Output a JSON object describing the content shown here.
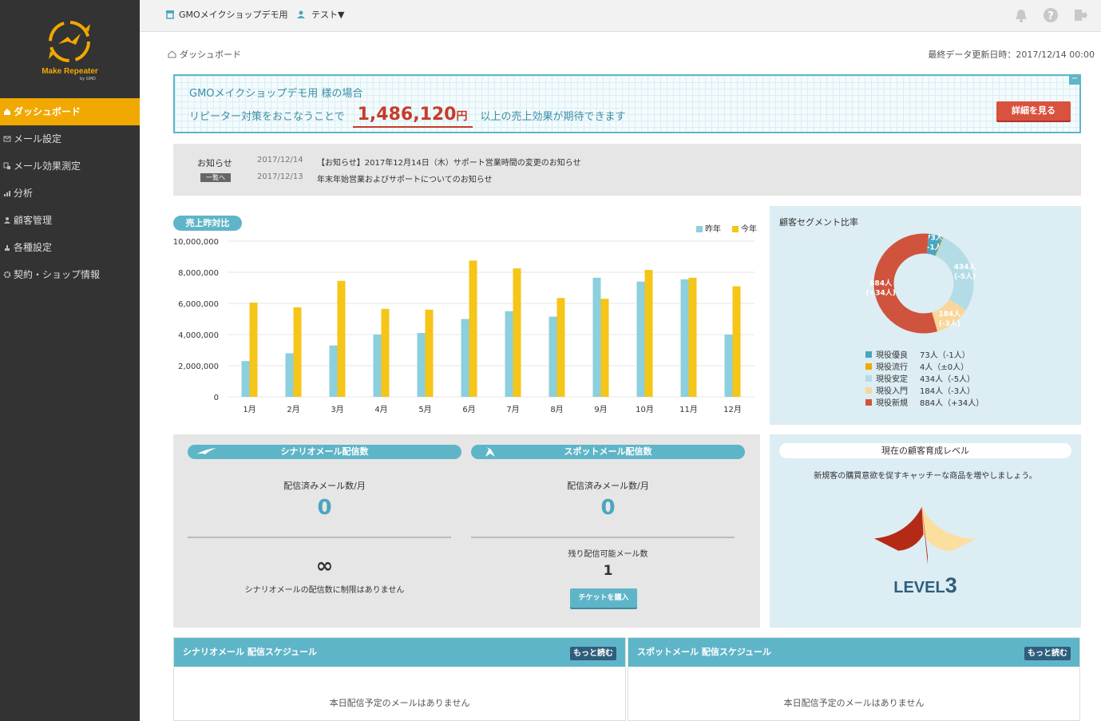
{
  "logo": {
    "text": "Make Repeater",
    "sub": "by GMO"
  },
  "nav": [
    {
      "label": "ダッシュボード",
      "icon": "home-icon",
      "active": true
    },
    {
      "label": "メール設定",
      "icon": "mail-icon"
    },
    {
      "label": "メール効果測定",
      "icon": "measure-icon"
    },
    {
      "label": "分析",
      "icon": "bar-chart-icon"
    },
    {
      "label": "顧客管理",
      "icon": "person-icon"
    },
    {
      "label": "各種設定",
      "icon": "settings-icon"
    },
    {
      "label": "契約・ショップ情報",
      "icon": "gear-icon"
    }
  ],
  "topbar": {
    "shop": "GMOメイクショップデモ用",
    "user": "テスト▼"
  },
  "breadcrumb": "ダッシュボード",
  "updated": "最終データ更新日時：2017/12/14 00:00",
  "banner": {
    "line1": "GMOメイクショップデモ用 様の場合",
    "prefix": "リピーター対策をおこなうことで",
    "amount": "1,486,120",
    "unit": "円",
    "suffix": "以上の売上効果が期待できます",
    "button": "詳細を見る",
    "minimize": "−"
  },
  "news": {
    "label": "お知らせ",
    "more": "一覧へ",
    "items": [
      {
        "date": "2017/12/14",
        "text": "【お知らせ】2017年12月14日（木）サポート営業時間の変更のお知らせ"
      },
      {
        "date": "2017/12/13",
        "text": "年末年始営業およびサポートについてのお知らせ"
      }
    ]
  },
  "sales": {
    "tag": "売上昨対比",
    "legend_prev": "昨年",
    "legend_curr": "今年"
  },
  "chart_data": {
    "type": "bar",
    "categories": [
      "1月",
      "2月",
      "3月",
      "4月",
      "5月",
      "6月",
      "7月",
      "8月",
      "9月",
      "10月",
      "11月",
      "12月"
    ],
    "series": [
      {
        "name": "昨年",
        "color": "#8ccfdd",
        "values": [
          2300000,
          2800000,
          3300000,
          4000000,
          4100000,
          5000000,
          5500000,
          5150000,
          7650000,
          7400000,
          7550000,
          4000000
        ]
      },
      {
        "name": "今年",
        "color": "#f5c518",
        "values": [
          6050000,
          5750000,
          7450000,
          5650000,
          5600000,
          8750000,
          8250000,
          6350000,
          6300000,
          8150000,
          7650000,
          7100000
        ]
      }
    ],
    "ylim": [
      0,
      10000000
    ],
    "yticks": [
      "0",
      "2,000,000",
      "4,000,000",
      "6,000,000",
      "8,000,000",
      "10,000,000"
    ],
    "grid": true,
    "legend": "top-right"
  },
  "segment": {
    "title": "顧客セグメント比率",
    "slices": [
      {
        "label": "現役優良",
        "count": 73,
        "value": "73人（-1人）",
        "d1": "73人",
        "d2": "(-1人)",
        "color": "#4aa5c0"
      },
      {
        "label": "現役流行",
        "count": 4,
        "value": "4人（±0人）",
        "d1": "",
        "d2": "",
        "color": "#f1a800"
      },
      {
        "label": "現役安定",
        "count": 434,
        "value": "434人（-5人）",
        "d1": "434人",
        "d2": "(-5人)",
        "color": "#b4dce6"
      },
      {
        "label": "現役入門",
        "count": 184,
        "value": "184人（-3人）",
        "d1": "184人",
        "d2": "(-3人)",
        "color": "#f9d79a"
      },
      {
        "label": "現役新規",
        "count": 884,
        "value": "884人（+34人）",
        "d1": "884人",
        "d2": "(+34人)",
        "color": "#cf533d"
      }
    ]
  },
  "scenario": {
    "title": "シナリオメール配信数",
    "sent_label": "配信済みメール数/月",
    "sent": "0",
    "limit": "∞",
    "limit_text": "シナリオメールの配信数に制限はありません"
  },
  "spot": {
    "title": "スポットメール配信数",
    "sent_label": "配信済みメール数/月",
    "sent": "0",
    "remain_label": "残り配信可能メール数",
    "remain": "1",
    "button": "チケットを購入"
  },
  "level": {
    "title": "現在の顧客育成レベル",
    "desc": "新規客の購買意欲を促すキャッチーな商品を増やしましょう。",
    "word": "LEVEL",
    "num": "3",
    "value": 3,
    "max": 5
  },
  "schedule_scenario": {
    "title": "シナリオメール 配信スケジュール",
    "more": "もっと読む",
    "empty": "本日配信予定のメールはありません"
  },
  "schedule_spot": {
    "title": "スポットメール 配信スケジュール",
    "more": "もっと読む",
    "empty": "本日配信予定のメールはありません"
  }
}
